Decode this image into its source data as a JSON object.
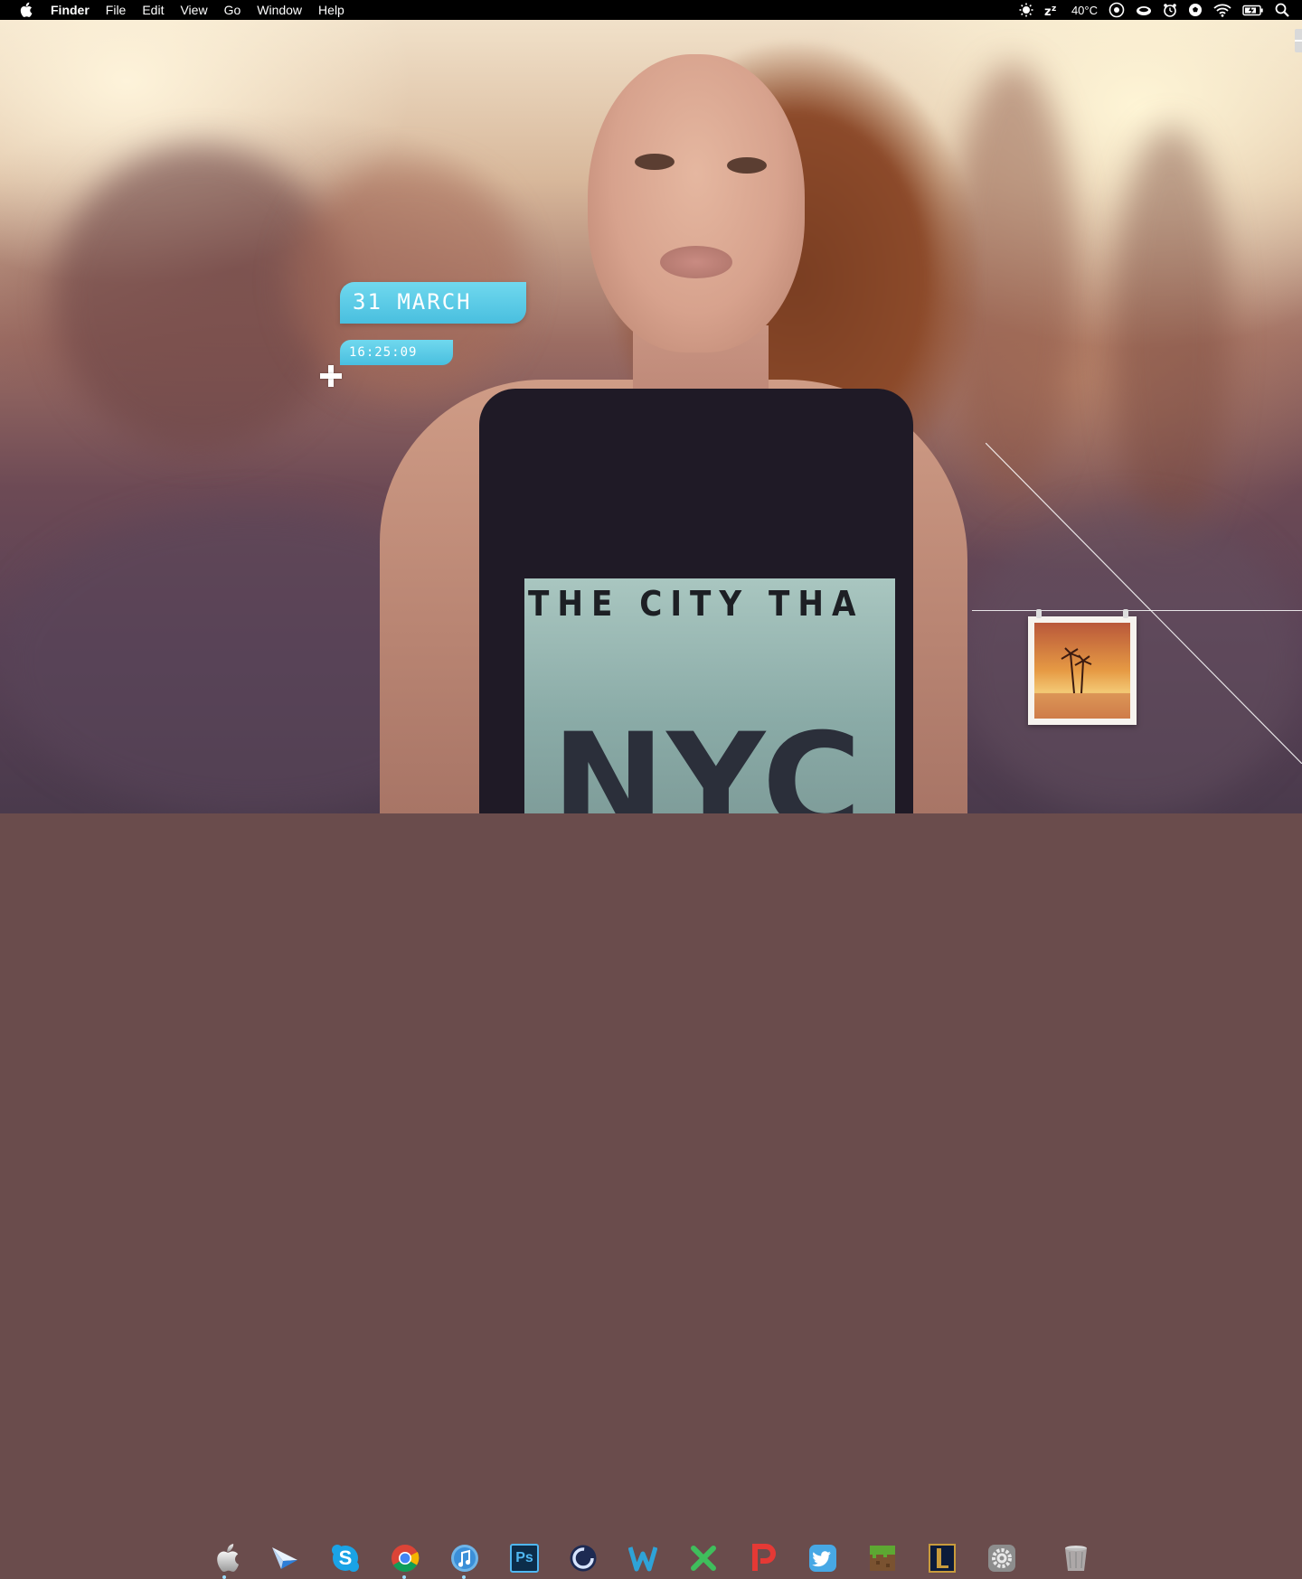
{
  "menubar": {
    "app_name": "Finder",
    "menus": [
      "File",
      "Edit",
      "View",
      "Go",
      "Window",
      "Help"
    ],
    "temperature": "40°C"
  },
  "widgets": {
    "clock": {
      "date": "31 MARCH",
      "time": "16:25:09"
    }
  },
  "wallpaper": {
    "shirt_text": "THE CITY THA",
    "shirt_big_text": "NYC"
  },
  "dock": {
    "items": [
      {
        "name": "finder-apple",
        "running": true
      },
      {
        "name": "airmail",
        "running": false
      },
      {
        "name": "skype",
        "running": false
      },
      {
        "name": "chrome",
        "running": true
      },
      {
        "name": "itunes",
        "running": true
      },
      {
        "name": "photoshop",
        "running": false
      },
      {
        "name": "cinema4d",
        "running": false
      },
      {
        "name": "wunderlist",
        "running": false
      },
      {
        "name": "xbox",
        "running": false
      },
      {
        "name": "pocket",
        "running": false
      },
      {
        "name": "twitter",
        "running": false
      },
      {
        "name": "minecraft",
        "running": false
      },
      {
        "name": "league-of-legends",
        "running": false
      },
      {
        "name": "system-preferences",
        "running": false
      },
      {
        "name": "trash",
        "running": false
      }
    ]
  },
  "colors": {
    "widget_accent": "#49bfdf",
    "menubar_bg": "#000000"
  }
}
